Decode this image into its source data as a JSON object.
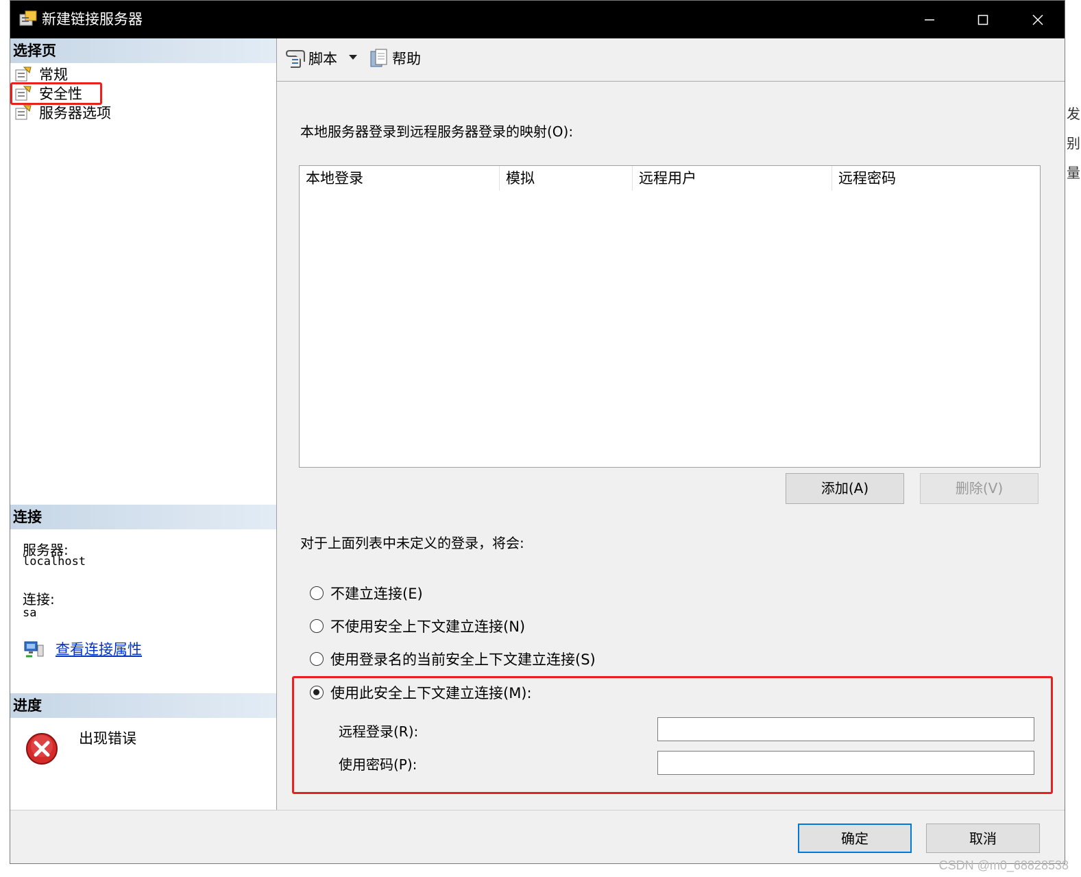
{
  "window": {
    "title": "新建链接服务器",
    "controls": [
      "minimize-icon",
      "maximize-icon",
      "close-icon"
    ]
  },
  "sidebar": {
    "select_page_header": "选择页",
    "items": [
      {
        "label": "常规",
        "icon": "page-settings-icon",
        "selected": false
      },
      {
        "label": "安全性",
        "icon": "page-settings-icon",
        "selected": true
      },
      {
        "label": "服务器选项",
        "icon": "page-settings-icon",
        "selected": false
      }
    ],
    "connection_header": "连接",
    "server_label": "服务器:",
    "server_value": "localhost",
    "connection_label": "连接:",
    "connection_value": "sa",
    "view_properties_link": "查看连接属性",
    "progress_header": "进度",
    "progress_status": "出现错误",
    "progress_icon": "error-icon"
  },
  "toolbar": {
    "script_label": "脚本",
    "help_label": "帮助"
  },
  "main": {
    "mapping_label": "本地服务器登录到远程服务器登录的映射(O):",
    "grid_columns": [
      "本地登录",
      "模拟",
      "远程用户",
      "远程密码"
    ],
    "grid_rows": [],
    "add_button": "添加(A)",
    "remove_button": "删除(V)",
    "undefined_login_label": "对于上面列表中未定义的登录，将会:",
    "options": [
      {
        "label": "不建立连接(E)",
        "checked": false
      },
      {
        "label": "不使用安全上下文建立连接(N)",
        "checked": false
      },
      {
        "label": "使用登录名的当前安全上下文建立连接(S)",
        "checked": false
      },
      {
        "label": "使用此安全上下文建立连接(M):",
        "checked": true
      }
    ],
    "remote_login_label": "远程登录(R):",
    "remote_login_value": "",
    "password_label": "使用密码(P):",
    "password_value": ""
  },
  "footer": {
    "ok_button": "确定",
    "cancel_button": "取消"
  },
  "watermark": "CSDN @m0_68828538",
  "edge_fragments": [
    "发",
    "别",
    "量"
  ],
  "colors": {
    "highlight_red": "#e8201f",
    "link_blue": "#0033cc",
    "section_header": "#c6d6e6",
    "default_button_border": "#0078d7"
  }
}
